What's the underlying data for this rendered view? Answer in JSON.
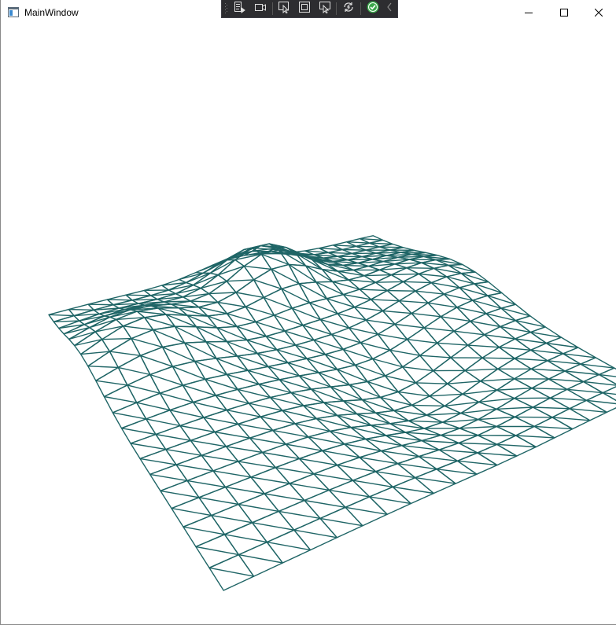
{
  "window": {
    "title": "MainWindow"
  },
  "caption_buttons": {
    "minimize_icon": "minimize-icon",
    "maximize_icon": "maximize-icon",
    "close_icon": "close-icon"
  },
  "debug_toolbar": {
    "items": [
      "go-to-live-visual-tree-icon",
      "track-focused-element-icon",
      "select-element-icon",
      "display-layout-adorners-icon",
      "track-focused-element-on-screen-icon",
      "hot-reload-icon",
      "binding-status-ok-icon",
      "collapse-toolbar-icon"
    ]
  },
  "colors": {
    "mesh_stroke": "#1f6566",
    "toolbar_bg": "#2d2d30",
    "status_ok": "#3aa84a"
  }
}
